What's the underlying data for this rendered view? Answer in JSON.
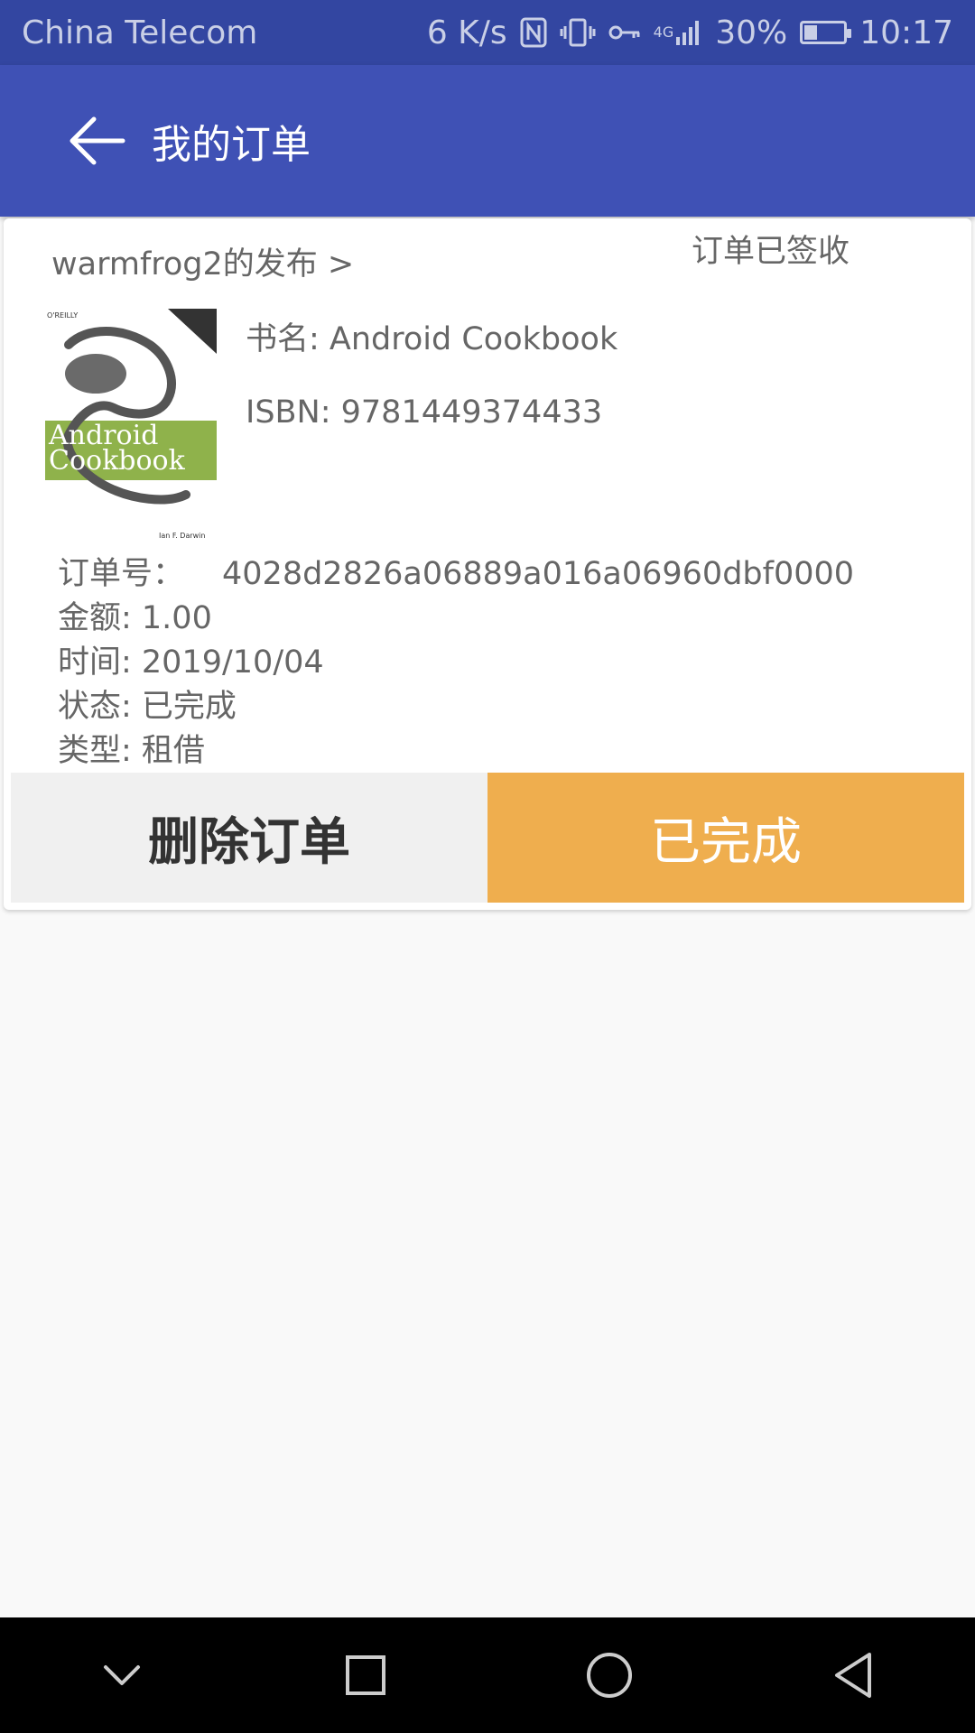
{
  "status_bar": {
    "carrier": "China Telecom",
    "speed": "6 K/s",
    "network": "4G",
    "battery": "30%",
    "battery_level": 0.3,
    "time": "10:17"
  },
  "app_bar": {
    "title": "我的订单"
  },
  "order": {
    "publisher_link": "warmfrog2的发布 >",
    "status_text": "订单已签收",
    "book_name": "书名: Android Cookbook",
    "isbn": "ISBN: 9781449374433",
    "cover": {
      "publisher": "O'REILLY",
      "title_line1": "Android",
      "title_line2": "Cookbook",
      "author": "Ian F. Darwin"
    },
    "order_no_label": "订单号：",
    "order_no": "4028d2826a06889a016a06960dbf0000",
    "amount": "金额: 1.00",
    "time": "时间: 2019/10/04",
    "state": "状态: 已完成",
    "type": "类型: 租借",
    "delete_label": "删除订单",
    "done_label": "已完成"
  },
  "colors": {
    "primary": "#3f51b5",
    "primary_dark": "#3346a1",
    "accent": "#efae4e"
  },
  "nav_bar": {
    "icons": [
      "chevron-down-icon",
      "square-icon",
      "circle-icon",
      "triangle-icon"
    ]
  }
}
